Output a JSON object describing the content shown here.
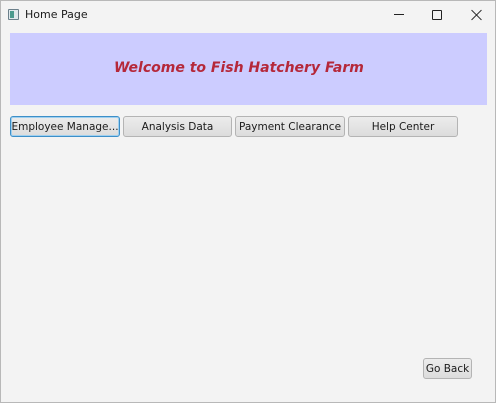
{
  "window": {
    "title": "Home Page",
    "icon": "java-app-icon"
  },
  "controls": {
    "minimize": "minimize-icon",
    "maximize": "maximize-icon",
    "close": "close-icon"
  },
  "banner": {
    "title": "Welcome to Fish Hatchery Farm",
    "background": "#ccccff",
    "title_color": "#b5283a"
  },
  "nav": {
    "buttons": [
      {
        "label": "Employee Manage..."
      },
      {
        "label": "Analysis Data"
      },
      {
        "label": "Payment Clearance"
      },
      {
        "label": "Help Center"
      }
    ]
  },
  "footer": {
    "back_label": "Go Back"
  }
}
